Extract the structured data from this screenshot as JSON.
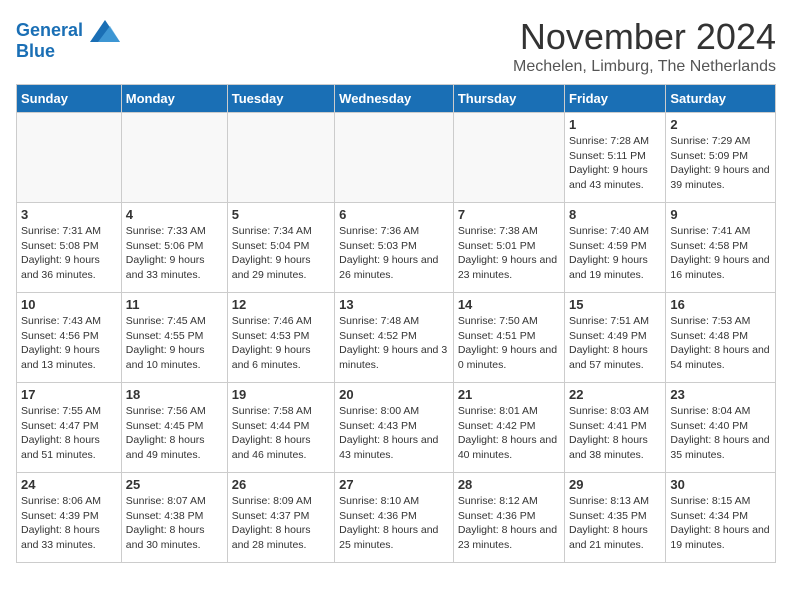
{
  "header": {
    "logo_line1": "General",
    "logo_line2": "Blue",
    "month_title": "November 2024",
    "location": "Mechelen, Limburg, The Netherlands"
  },
  "days_of_week": [
    "Sunday",
    "Monday",
    "Tuesday",
    "Wednesday",
    "Thursday",
    "Friday",
    "Saturday"
  ],
  "weeks": [
    [
      {
        "day": "",
        "info": ""
      },
      {
        "day": "",
        "info": ""
      },
      {
        "day": "",
        "info": ""
      },
      {
        "day": "",
        "info": ""
      },
      {
        "day": "",
        "info": ""
      },
      {
        "day": "1",
        "info": "Sunrise: 7:28 AM\nSunset: 5:11 PM\nDaylight: 9 hours and 43 minutes."
      },
      {
        "day": "2",
        "info": "Sunrise: 7:29 AM\nSunset: 5:09 PM\nDaylight: 9 hours and 39 minutes."
      }
    ],
    [
      {
        "day": "3",
        "info": "Sunrise: 7:31 AM\nSunset: 5:08 PM\nDaylight: 9 hours and 36 minutes."
      },
      {
        "day": "4",
        "info": "Sunrise: 7:33 AM\nSunset: 5:06 PM\nDaylight: 9 hours and 33 minutes."
      },
      {
        "day": "5",
        "info": "Sunrise: 7:34 AM\nSunset: 5:04 PM\nDaylight: 9 hours and 29 minutes."
      },
      {
        "day": "6",
        "info": "Sunrise: 7:36 AM\nSunset: 5:03 PM\nDaylight: 9 hours and 26 minutes."
      },
      {
        "day": "7",
        "info": "Sunrise: 7:38 AM\nSunset: 5:01 PM\nDaylight: 9 hours and 23 minutes."
      },
      {
        "day": "8",
        "info": "Sunrise: 7:40 AM\nSunset: 4:59 PM\nDaylight: 9 hours and 19 minutes."
      },
      {
        "day": "9",
        "info": "Sunrise: 7:41 AM\nSunset: 4:58 PM\nDaylight: 9 hours and 16 minutes."
      }
    ],
    [
      {
        "day": "10",
        "info": "Sunrise: 7:43 AM\nSunset: 4:56 PM\nDaylight: 9 hours and 13 minutes."
      },
      {
        "day": "11",
        "info": "Sunrise: 7:45 AM\nSunset: 4:55 PM\nDaylight: 9 hours and 10 minutes."
      },
      {
        "day": "12",
        "info": "Sunrise: 7:46 AM\nSunset: 4:53 PM\nDaylight: 9 hours and 6 minutes."
      },
      {
        "day": "13",
        "info": "Sunrise: 7:48 AM\nSunset: 4:52 PM\nDaylight: 9 hours and 3 minutes."
      },
      {
        "day": "14",
        "info": "Sunrise: 7:50 AM\nSunset: 4:51 PM\nDaylight: 9 hours and 0 minutes."
      },
      {
        "day": "15",
        "info": "Sunrise: 7:51 AM\nSunset: 4:49 PM\nDaylight: 8 hours and 57 minutes."
      },
      {
        "day": "16",
        "info": "Sunrise: 7:53 AM\nSunset: 4:48 PM\nDaylight: 8 hours and 54 minutes."
      }
    ],
    [
      {
        "day": "17",
        "info": "Sunrise: 7:55 AM\nSunset: 4:47 PM\nDaylight: 8 hours and 51 minutes."
      },
      {
        "day": "18",
        "info": "Sunrise: 7:56 AM\nSunset: 4:45 PM\nDaylight: 8 hours and 49 minutes."
      },
      {
        "day": "19",
        "info": "Sunrise: 7:58 AM\nSunset: 4:44 PM\nDaylight: 8 hours and 46 minutes."
      },
      {
        "day": "20",
        "info": "Sunrise: 8:00 AM\nSunset: 4:43 PM\nDaylight: 8 hours and 43 minutes."
      },
      {
        "day": "21",
        "info": "Sunrise: 8:01 AM\nSunset: 4:42 PM\nDaylight: 8 hours and 40 minutes."
      },
      {
        "day": "22",
        "info": "Sunrise: 8:03 AM\nSunset: 4:41 PM\nDaylight: 8 hours and 38 minutes."
      },
      {
        "day": "23",
        "info": "Sunrise: 8:04 AM\nSunset: 4:40 PM\nDaylight: 8 hours and 35 minutes."
      }
    ],
    [
      {
        "day": "24",
        "info": "Sunrise: 8:06 AM\nSunset: 4:39 PM\nDaylight: 8 hours and 33 minutes."
      },
      {
        "day": "25",
        "info": "Sunrise: 8:07 AM\nSunset: 4:38 PM\nDaylight: 8 hours and 30 minutes."
      },
      {
        "day": "26",
        "info": "Sunrise: 8:09 AM\nSunset: 4:37 PM\nDaylight: 8 hours and 28 minutes."
      },
      {
        "day": "27",
        "info": "Sunrise: 8:10 AM\nSunset: 4:36 PM\nDaylight: 8 hours and 25 minutes."
      },
      {
        "day": "28",
        "info": "Sunrise: 8:12 AM\nSunset: 4:36 PM\nDaylight: 8 hours and 23 minutes."
      },
      {
        "day": "29",
        "info": "Sunrise: 8:13 AM\nSunset: 4:35 PM\nDaylight: 8 hours and 21 minutes."
      },
      {
        "day": "30",
        "info": "Sunrise: 8:15 AM\nSunset: 4:34 PM\nDaylight: 8 hours and 19 minutes."
      }
    ]
  ]
}
